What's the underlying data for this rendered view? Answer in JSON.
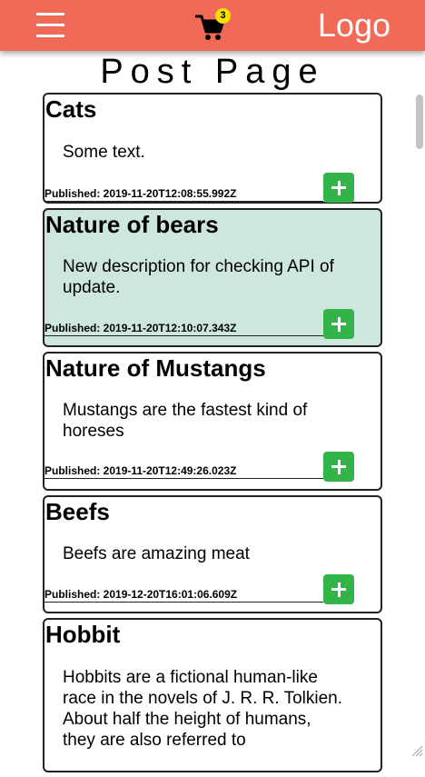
{
  "header": {
    "logo_text": "Logo",
    "cart_count": "3",
    "menu_icon": "hamburger-menu-icon",
    "cart_icon": "shopping-cart-icon",
    "background_color": "#f06a57"
  },
  "page": {
    "title": "Post Page"
  },
  "posts": [
    {
      "title": "Cats",
      "description": "Some text.",
      "published": "Published: 2019-11-20T12:08:55.992Z",
      "highlighted": false
    },
    {
      "title": "Nature of bears",
      "description": "New description for checking API of update.",
      "published": "Published: 2019-11-20T12:10:07.343Z",
      "highlighted": true
    },
    {
      "title": "Nature of Mustangs",
      "description": "Mustangs are the fastest kind of horeses",
      "published": "Published: 2019-11-20T12:49:26.023Z",
      "highlighted": false
    },
    {
      "title": "Beefs",
      "description": "Beefs are amazing meat",
      "published": "Published: 2019-12-20T16:01:06.609Z",
      "highlighted": false
    },
    {
      "title": "Hobbit",
      "description": "Hobbits are a fictional human-like race in the novels of J. R. R. Tolkien. About half the height of humans, they are also referred to",
      "published": "",
      "highlighted": false
    }
  ],
  "colors": {
    "highlight_card": "#cde6de",
    "add_button": "#33b449",
    "cart_badge": "#f6e200"
  },
  "add_button_icon": "plus-icon"
}
